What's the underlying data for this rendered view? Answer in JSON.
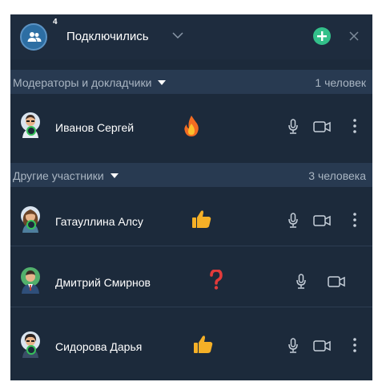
{
  "header": {
    "count_badge": "4",
    "title": "Подключились"
  },
  "sections": {
    "moderators": {
      "title": "Модераторы и докладчики",
      "count": "1 человек"
    },
    "others": {
      "title": "Другие участники",
      "count": "3 человека"
    }
  },
  "participants": [
    {
      "name": "Иванов Сергей",
      "reaction": "fire-emoji",
      "online": true
    },
    {
      "name": "Гатауллина Алсу",
      "reaction": "thumbs-up-emoji",
      "online": true
    },
    {
      "name": "Дмитрий Смирнов",
      "reaction": "question-mark-emoji",
      "online": false
    },
    {
      "name": "Сидорова Дарья",
      "reaction": "thumbs-up-emoji",
      "online": true
    }
  ],
  "colors": {
    "panel_bg": "#1c2a3b",
    "section_bg": "#283a51",
    "add_button": "#33c08a",
    "online_dot": "#35c25a",
    "reaction_question": "#e23b3b",
    "reaction_thumb": "#f5b027"
  }
}
